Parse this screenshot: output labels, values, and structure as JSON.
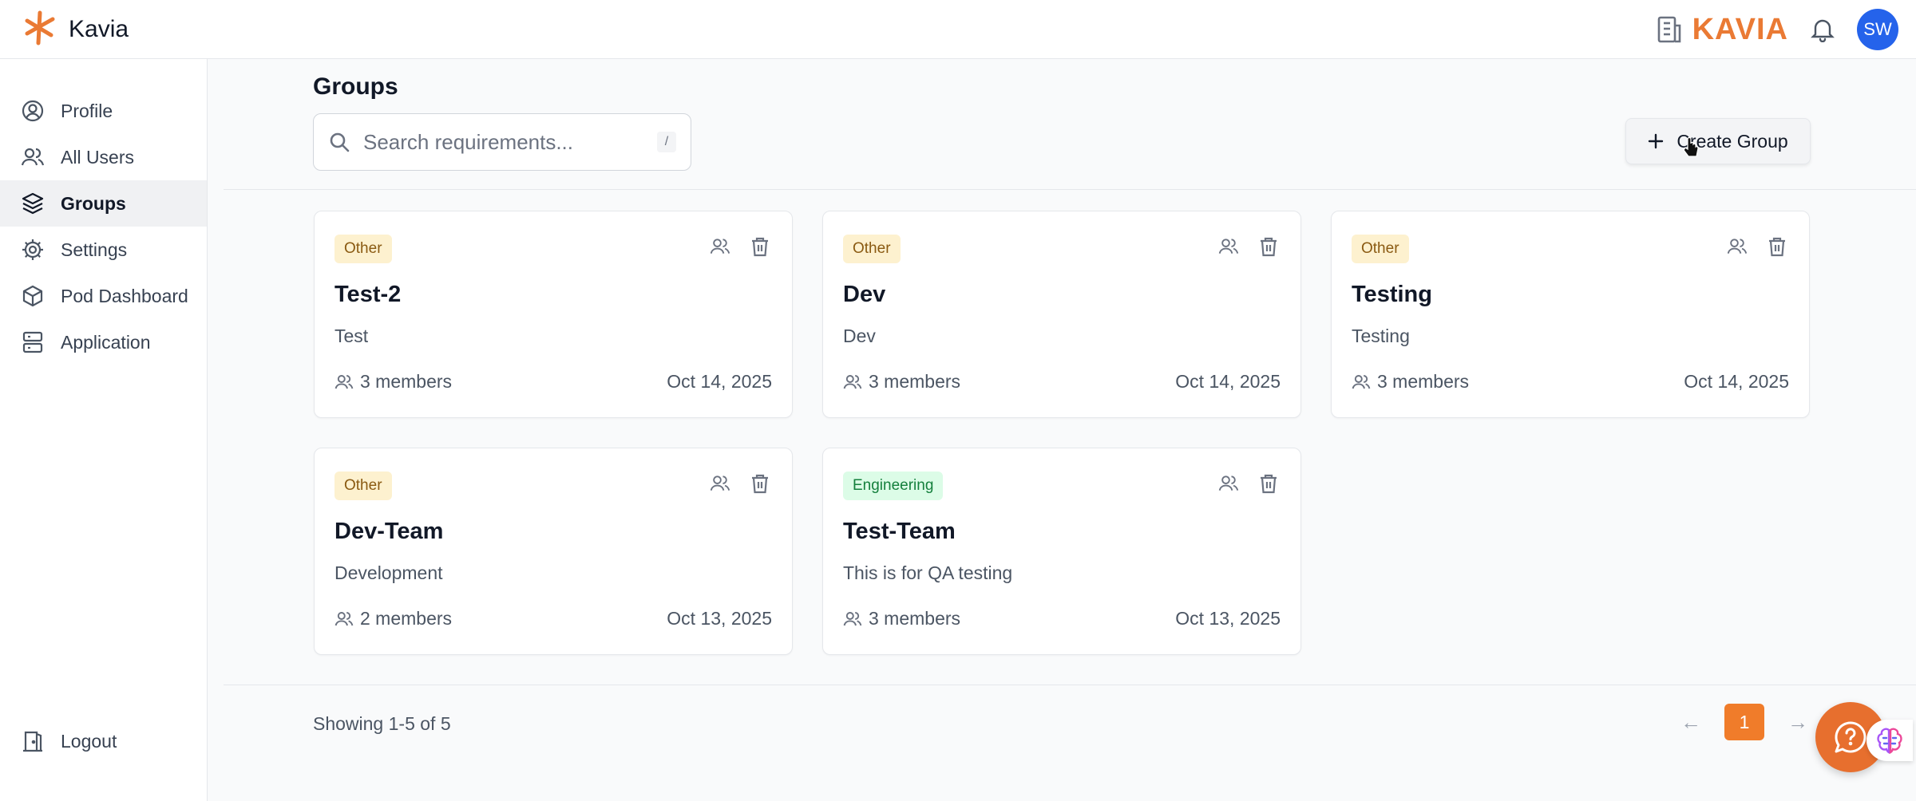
{
  "app": {
    "name": "Kavia",
    "brand_word": "KAVIA",
    "accent": "#ea7a34"
  },
  "user": {
    "initials": "SW",
    "avatar_color": "#2563eb"
  },
  "sidebar": {
    "items": [
      {
        "label": "Profile",
        "icon": "user-circle-icon"
      },
      {
        "label": "All Users",
        "icon": "users-icon"
      },
      {
        "label": "Groups",
        "icon": "layers-icon",
        "active": true
      },
      {
        "label": "Settings",
        "icon": "gear-icon"
      },
      {
        "label": "Pod Dashboard",
        "icon": "cube-icon"
      },
      {
        "label": "Application",
        "icon": "server-icon"
      }
    ],
    "logout": {
      "label": "Logout",
      "icon": "door-exit-icon"
    }
  },
  "main": {
    "title": "Groups",
    "search": {
      "placeholder": "Search requirements...",
      "shortcut": "/"
    },
    "create_button": "Create Group",
    "groups": [
      {
        "category": "Other",
        "name": "Test-2",
        "description": "Test",
        "members": "3 members",
        "date": "Oct 14, 2025"
      },
      {
        "category": "Other",
        "name": "Dev",
        "description": "Dev",
        "members": "3 members",
        "date": "Oct 14, 2025"
      },
      {
        "category": "Other",
        "name": "Testing",
        "description": "Testing",
        "members": "3 members",
        "date": "Oct 14, 2025"
      },
      {
        "category": "Other",
        "name": "Dev-Team",
        "description": "Development",
        "members": "2 members",
        "date": "Oct 13, 2025"
      },
      {
        "category": "Engineering",
        "name": "Test-Team",
        "description": "This is for QA testing",
        "members": "3 members",
        "date": "Oct 13, 2025"
      }
    ],
    "pagination": {
      "showing": "Showing 1-5 of 5",
      "prev": "←",
      "current": "1",
      "next": "→"
    }
  }
}
